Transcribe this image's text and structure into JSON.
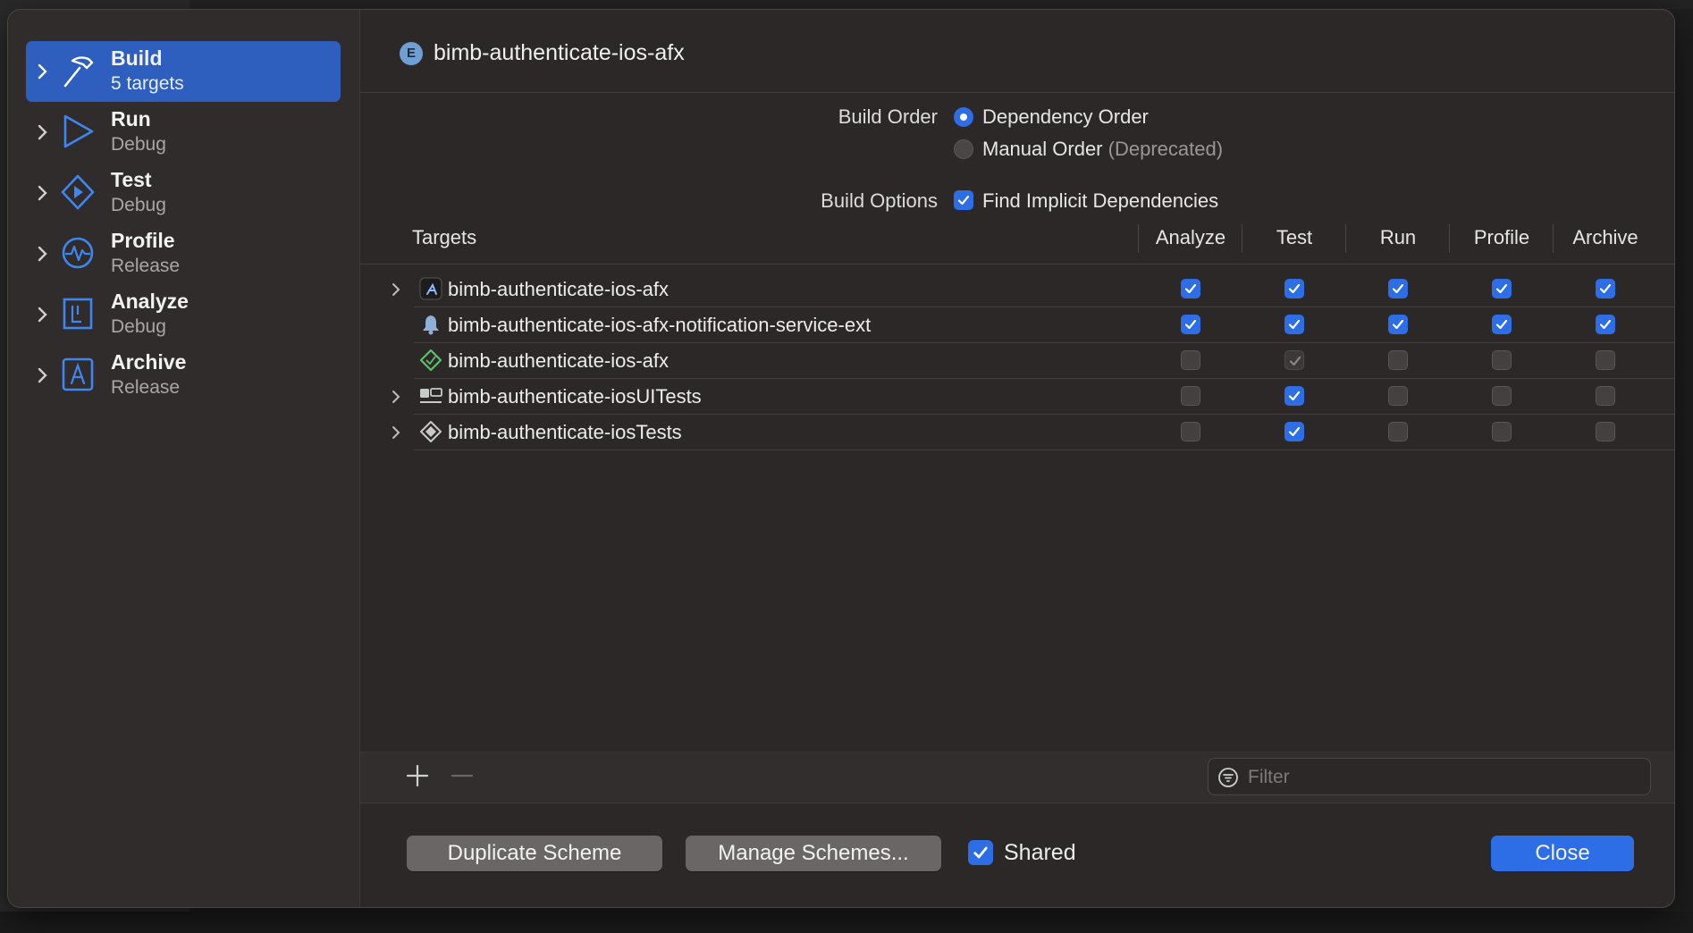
{
  "sidebar": {
    "items": [
      {
        "title": "Build",
        "subtitle": "5 targets"
      },
      {
        "title": "Run",
        "subtitle": "Debug"
      },
      {
        "title": "Test",
        "subtitle": "Debug"
      },
      {
        "title": "Profile",
        "subtitle": "Release"
      },
      {
        "title": "Analyze",
        "subtitle": "Debug"
      },
      {
        "title": "Archive",
        "subtitle": "Release"
      }
    ]
  },
  "header": {
    "badge": "E",
    "title": "bimb-authenticate-ios-afx"
  },
  "build_order": {
    "label": "Build Order",
    "selected": "Dependency Order",
    "option_dependency": "Dependency Order",
    "option_manual": "Manual Order",
    "option_manual_note": "(Deprecated)"
  },
  "build_options": {
    "label": "Build Options",
    "find_implicit": "Find Implicit Dependencies",
    "find_implicit_checked": true
  },
  "table": {
    "columns": [
      "Targets",
      "Analyze",
      "Test",
      "Run",
      "Profile",
      "Archive"
    ],
    "rows": [
      {
        "name": "bimb-authenticate-ios-afx",
        "icon": "app-target-icon",
        "expandable": true,
        "checks": [
          true,
          true,
          true,
          true,
          true
        ]
      },
      {
        "name": "bimb-authenticate-ios-afx-notification-service-ext",
        "icon": "notification-extension-icon",
        "expandable": false,
        "checks": [
          true,
          true,
          true,
          true,
          true
        ]
      },
      {
        "name": "bimb-authenticate-ios-afx",
        "icon": "test-plan-icon",
        "expandable": false,
        "checks": [
          false,
          "implicit",
          false,
          false,
          false
        ]
      },
      {
        "name": "bimb-authenticate-iosUITests",
        "icon": "ui-test-bundle-icon",
        "expandable": true,
        "checks": [
          false,
          true,
          false,
          false,
          false
        ]
      },
      {
        "name": "bimb-authenticate-iosTests",
        "icon": "unit-test-bundle-icon",
        "expandable": true,
        "checks": [
          false,
          true,
          false,
          false,
          false
        ]
      }
    ]
  },
  "filter": {
    "placeholder": "Filter"
  },
  "footer": {
    "duplicate": "Duplicate Scheme",
    "manage": "Manage Schemes...",
    "shared": "Shared",
    "shared_checked": true,
    "close": "Close"
  },
  "colors": {
    "accent": "#2d6ee6",
    "selection": "#2e5fbe",
    "sheet": "#2c2828",
    "sidebar": "#312c2c"
  }
}
